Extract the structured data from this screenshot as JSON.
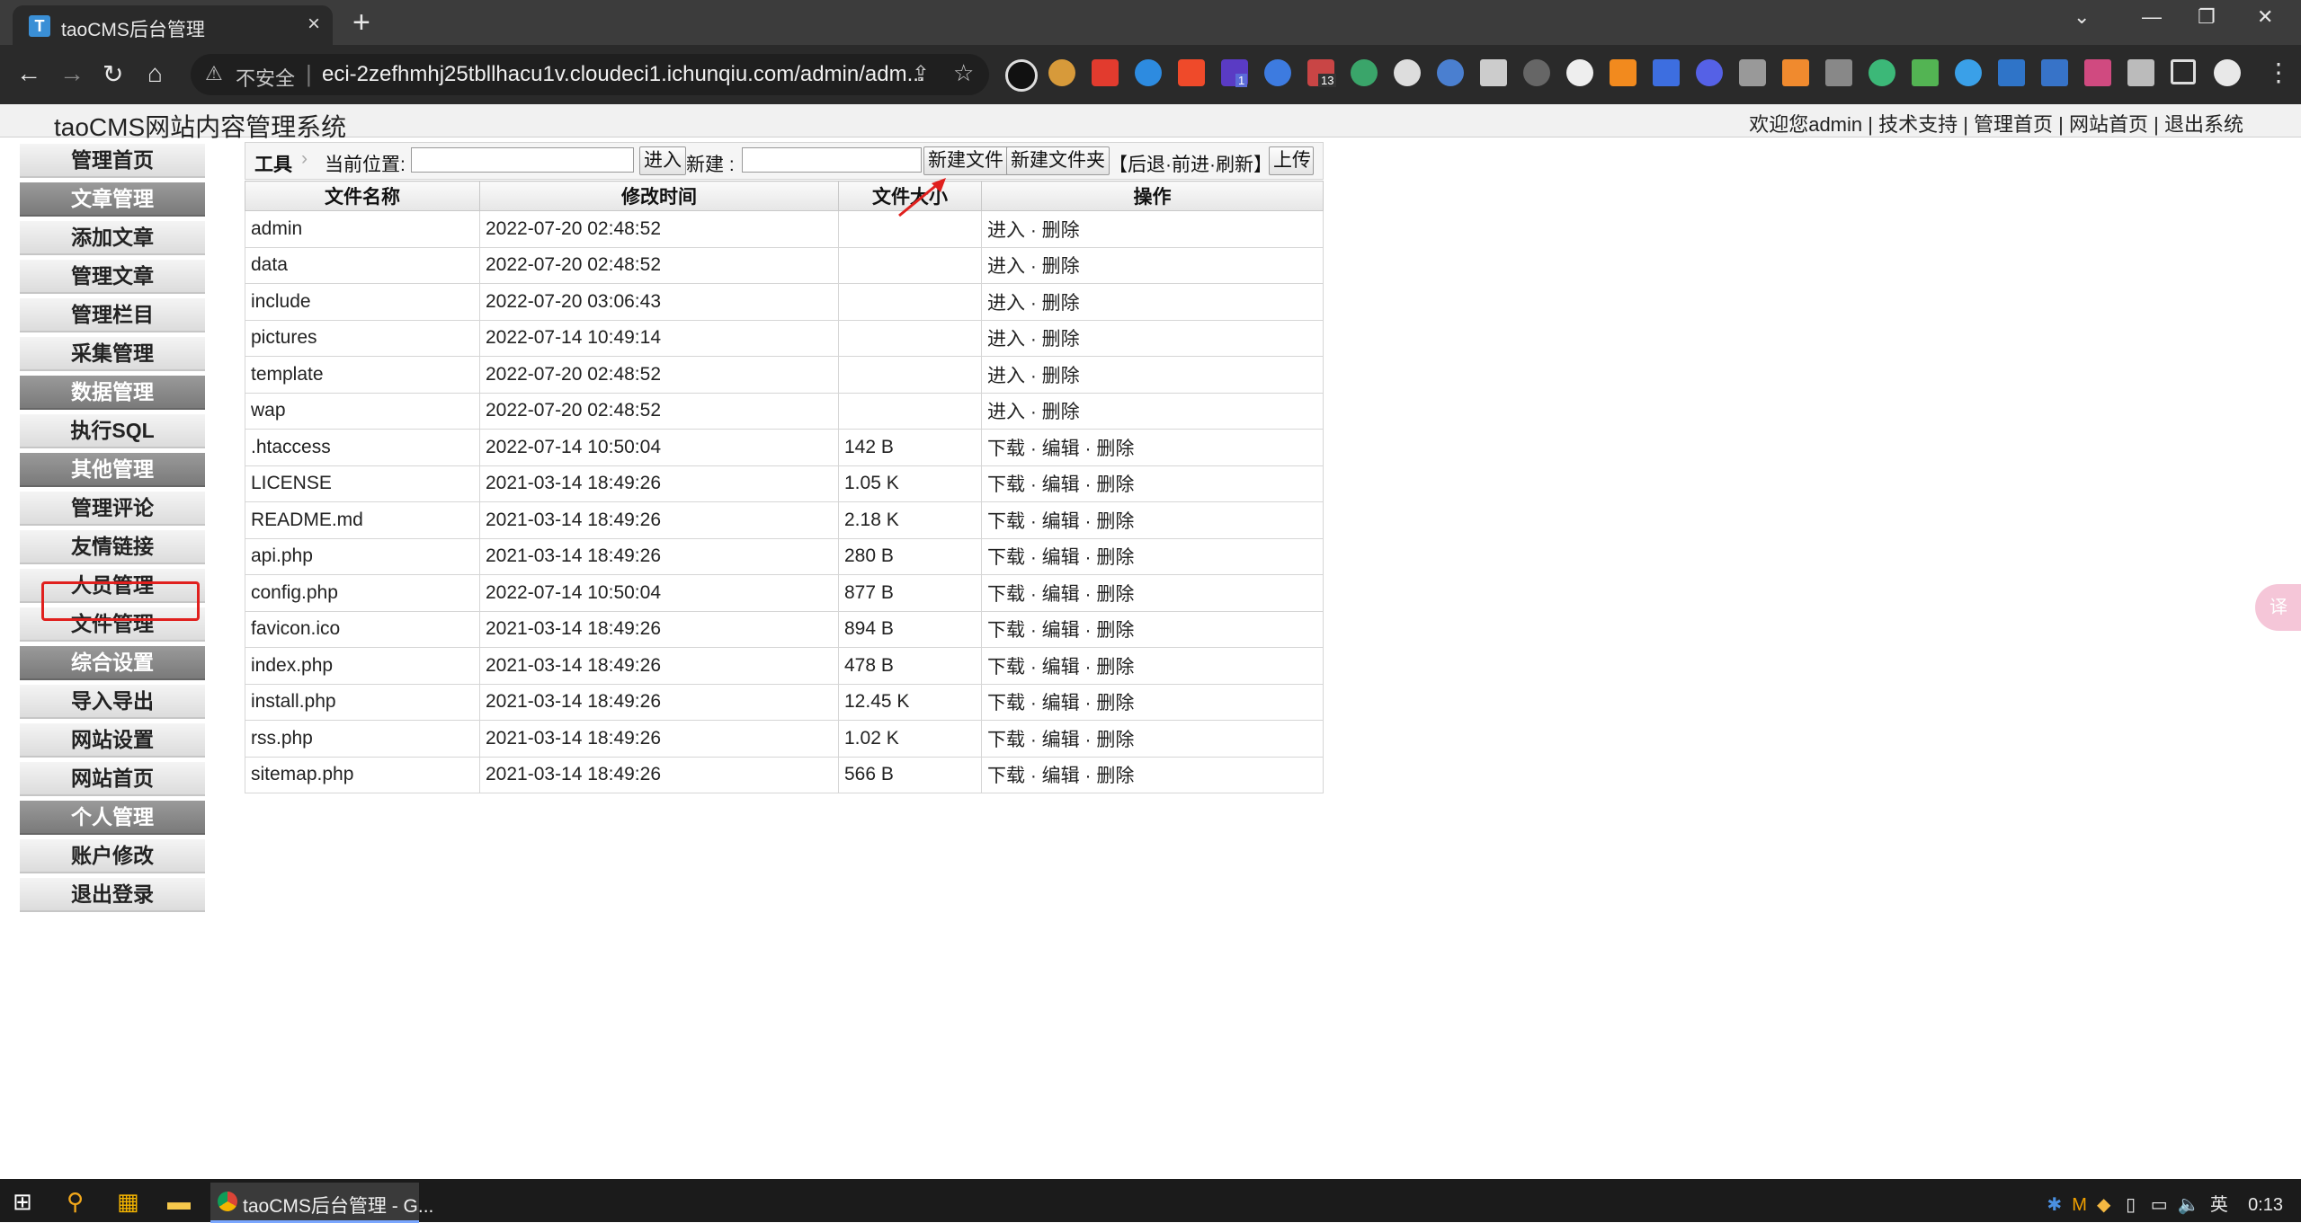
{
  "browser": {
    "tab_title": "taoCMS后台管理",
    "tab_close": "×",
    "new_tab": "+",
    "insecure_label": "不安全",
    "url": "eci-2zefhmhj25tbllhacu1v.cloudeci1.ichunqiu.com/admin/adm...",
    "ext_badge_1": "1",
    "ext_badge_13": "13"
  },
  "header": {
    "site_title": "taoCMS网站内容管理系统",
    "welcome": "欢迎您admin",
    "links": [
      "技术支持",
      "管理首页",
      "网站首页",
      "退出系统"
    ]
  },
  "sidebar": {
    "items": [
      {
        "label": "管理首页",
        "type": "item"
      },
      {
        "label": "文章管理",
        "type": "cat"
      },
      {
        "label": "添加文章",
        "type": "item"
      },
      {
        "label": "管理文章",
        "type": "item"
      },
      {
        "label": "管理栏目",
        "type": "item"
      },
      {
        "label": "采集管理",
        "type": "item"
      },
      {
        "label": "数据管理",
        "type": "cat"
      },
      {
        "label": "执行SQL",
        "type": "item"
      },
      {
        "label": "其他管理",
        "type": "cat"
      },
      {
        "label": "管理评论",
        "type": "item"
      },
      {
        "label": "友情链接",
        "type": "item"
      },
      {
        "label": "人员管理",
        "type": "item"
      },
      {
        "label": "文件管理",
        "type": "item"
      },
      {
        "label": "综合设置",
        "type": "cat"
      },
      {
        "label": "导入导出",
        "type": "item"
      },
      {
        "label": "网站设置",
        "type": "item"
      },
      {
        "label": "网站首页",
        "type": "item"
      },
      {
        "label": "个人管理",
        "type": "cat"
      },
      {
        "label": "账户修改",
        "type": "item"
      },
      {
        "label": "退出登录",
        "type": "item"
      }
    ]
  },
  "toolbar": {
    "tool_label": "工具",
    "location_label": "当前位置:",
    "enter_button": "进入",
    "new_label": "新建 :",
    "new_file_button": "新建文件",
    "new_folder_button": "新建文件夹",
    "nav_links": "【后退·前进·刷新】",
    "upload_button": "上传"
  },
  "table": {
    "headers": [
      "文件名称",
      "修改时间",
      "文件大小",
      "操作"
    ],
    "rows": [
      {
        "name": "admin",
        "time": "2022-07-20 02:48:52",
        "size": "",
        "ops": "进入 · 删除"
      },
      {
        "name": "data",
        "time": "2022-07-20 02:48:52",
        "size": "",
        "ops": "进入 · 删除"
      },
      {
        "name": "include",
        "time": "2022-07-20 03:06:43",
        "size": "",
        "ops": "进入 · 删除"
      },
      {
        "name": "pictures",
        "time": "2022-07-14 10:49:14",
        "size": "",
        "ops": "进入 · 删除"
      },
      {
        "name": "template",
        "time": "2022-07-20 02:48:52",
        "size": "",
        "ops": "进入 · 删除"
      },
      {
        "name": "wap",
        "time": "2022-07-20 02:48:52",
        "size": "",
        "ops": "进入 · 删除"
      },
      {
        "name": ".htaccess",
        "time": "2022-07-14 10:50:04",
        "size": "142 B",
        "ops": "下载 · 编辑 · 删除"
      },
      {
        "name": "LICENSE",
        "time": "2021-03-14 18:49:26",
        "size": "1.05 K",
        "ops": "下载 · 编辑 · 删除"
      },
      {
        "name": "README.md",
        "time": "2021-03-14 18:49:26",
        "size": "2.18 K",
        "ops": "下载 · 编辑 · 删除"
      },
      {
        "name": "api.php",
        "time": "2021-03-14 18:49:26",
        "size": "280 B",
        "ops": "下载 · 编辑 · 删除"
      },
      {
        "name": "config.php",
        "time": "2022-07-14 10:50:04",
        "size": "877 B",
        "ops": "下载 · 编辑 · 删除"
      },
      {
        "name": "favicon.ico",
        "time": "2021-03-14 18:49:26",
        "size": "894 B",
        "ops": "下载 · 编辑 · 删除"
      },
      {
        "name": "index.php",
        "time": "2021-03-14 18:49:26",
        "size": "478 B",
        "ops": "下载 · 编辑 · 删除"
      },
      {
        "name": "install.php",
        "time": "2021-03-14 18:49:26",
        "size": "12.45 K",
        "ops": "下载 · 编辑 · 删除"
      },
      {
        "name": "rss.php",
        "time": "2021-03-14 18:49:26",
        "size": "1.02 K",
        "ops": "下载 · 编辑 · 删除"
      },
      {
        "name": "sitemap.php",
        "time": "2021-03-14 18:49:26",
        "size": "566 B",
        "ops": "下载 · 编辑 · 删除"
      }
    ]
  },
  "taskbar": {
    "app_label": "taoCMS后台管理 - G...",
    "ime": "英",
    "time": "0:13"
  },
  "colors": {
    "highlight_box": "#e0201e",
    "category_bg": "#7a7a7a"
  }
}
